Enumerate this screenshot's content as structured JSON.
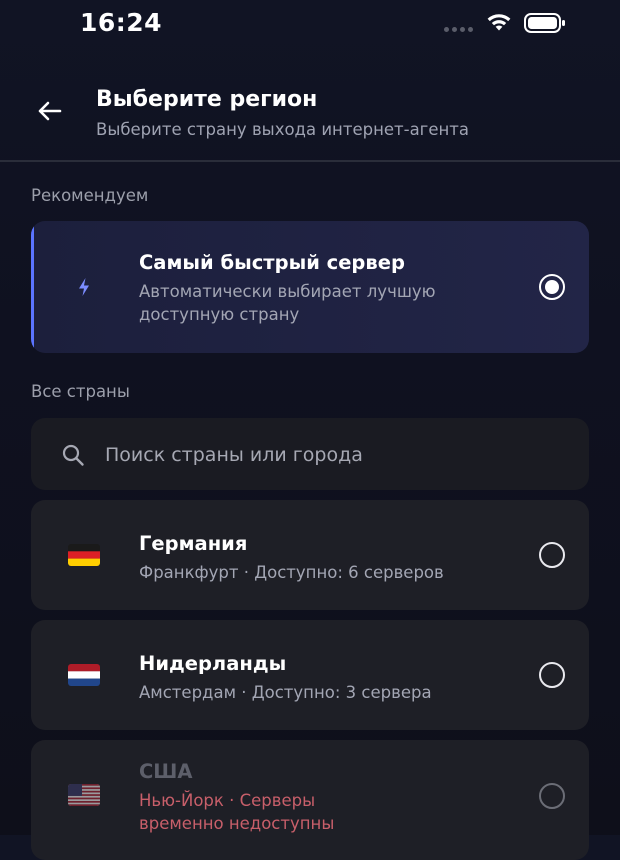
{
  "status_bar": {
    "time": "16:24"
  },
  "header": {
    "title": "Выберите регион",
    "subtitle": "Выберите страну выхода интернет-агента"
  },
  "recommended_section": {
    "label": "Рекомендуем",
    "option": {
      "title": "Самый быстрый сервер",
      "description_line1": "Автоматически выбирает лучшую",
      "description_line2": "доступную страну",
      "icon": "bolt-icon",
      "selected": true
    }
  },
  "all_countries_section": {
    "label": "Все страны",
    "search": {
      "placeholder": "Поиск страны или города",
      "value": ""
    },
    "countries": [
      {
        "name": "Германия",
        "detail": "Франкфурт · Доступно: 6 серверов",
        "flag": "germany-flag-icon",
        "selected": false,
        "available": true
      },
      {
        "name": "Нидерланды",
        "detail": "Амстердам · Доступно: 3 сервера",
        "flag": "netherlands-flag-icon",
        "selected": false,
        "available": true
      },
      {
        "name": "США",
        "detail_line1": "Нью-Йорк · Серверы",
        "detail_line2": "временно недоступны",
        "flag": "usa-flag-icon",
        "selected": false,
        "available": false
      }
    ]
  },
  "colors": {
    "accent": "#5b74ff",
    "error_text": "#c85f6a",
    "card_bg": "#1e1f26"
  }
}
